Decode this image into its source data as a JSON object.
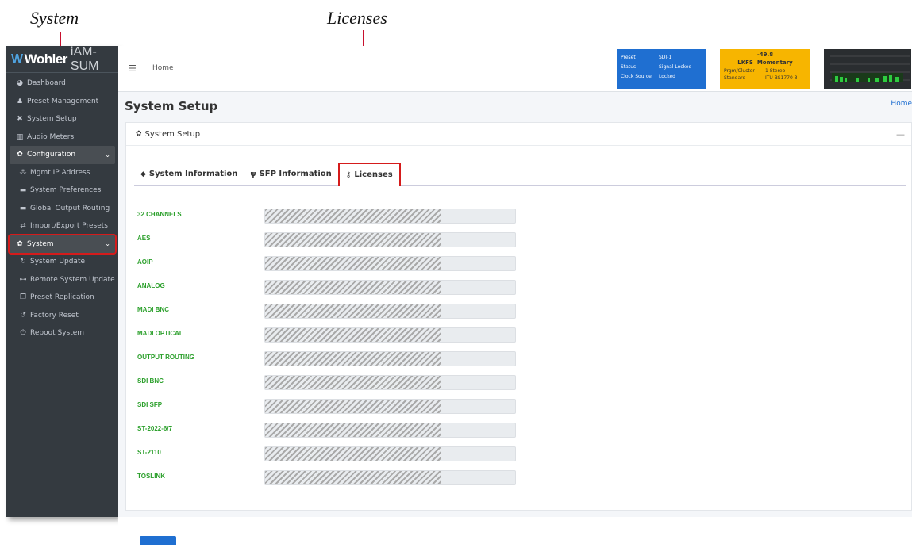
{
  "callouts": {
    "system": "System",
    "licenses": "Licenses"
  },
  "brand": {
    "logo": "Wohler",
    "product": "iAM-SUM"
  },
  "sidebar": {
    "items": [
      {
        "label": "Dashboard",
        "icon": "dashboard-icon"
      },
      {
        "label": "Preset Management",
        "icon": "users-icon"
      },
      {
        "label": "System Setup",
        "icon": "tools-icon"
      },
      {
        "label": "Audio Meters",
        "icon": "chart-icon"
      },
      {
        "label": "Configuration",
        "icon": "gear-icon"
      },
      {
        "label": "Mgmt IP Address",
        "icon": "network-icon"
      },
      {
        "label": "System Preferences",
        "icon": "keyboard-icon"
      },
      {
        "label": "Global Output Routing",
        "icon": "routing-icon"
      },
      {
        "label": "Import/Export Presets",
        "icon": "exchange-icon"
      },
      {
        "label": "System",
        "icon": "cogs-icon"
      },
      {
        "label": "System Update",
        "icon": "sync-icon"
      },
      {
        "label": "Remote System Update",
        "icon": "sitemap-icon"
      },
      {
        "label": "Preset Replication",
        "icon": "copy-icon"
      },
      {
        "label": "Factory Reset",
        "icon": "undo-icon"
      },
      {
        "label": "Reboot System",
        "icon": "power-icon"
      }
    ]
  },
  "topbar": {
    "home": "Home",
    "status_blue": [
      {
        "k": "Preset",
        "v": "SDI-1"
      },
      {
        "k": "Status",
        "v": "Signal Locked"
      },
      {
        "k": "Clock Source",
        "v": "Locked"
      }
    ],
    "status_yellow": {
      "value": "-49.8",
      "mode_k": "LKFS",
      "mode_v": "Momentary",
      "rows": [
        {
          "k": "Prgm/Cluster",
          "v": "1  Stereo"
        },
        {
          "k": "Standard",
          "v": "ITU BS1770 3"
        }
      ]
    }
  },
  "page": {
    "title": "System Setup",
    "breadcrumb": "Home",
    "card_title": "System Setup",
    "tabs": [
      {
        "label": "System Information",
        "icon": "tag-icon"
      },
      {
        "label": "SFP Information",
        "icon": "plug-icon"
      },
      {
        "label": "Licenses",
        "icon": "key-icon"
      }
    ],
    "licenses": [
      {
        "label": "32 CHANNELS",
        "level": 0.7
      },
      {
        "label": "AES",
        "level": 0.7
      },
      {
        "label": "AOIP",
        "level": 0.7
      },
      {
        "label": "ANALOG",
        "level": 0.7
      },
      {
        "label": "MADI BNC",
        "level": 0.7
      },
      {
        "label": "MADI OPTICAL",
        "level": 0.7
      },
      {
        "label": "OUTPUT ROUTING",
        "level": 0.7
      },
      {
        "label": "SDI BNC",
        "level": 0.7
      },
      {
        "label": "SDI SFP",
        "level": 0.7
      },
      {
        "label": "ST-2022-6/7",
        "level": 0.7
      },
      {
        "label": "ST-2110",
        "level": 0.7
      },
      {
        "label": "TOSLINK",
        "level": 0.7
      }
    ]
  },
  "colors": {
    "accent": "#1f6fd1",
    "highlight": "#d51b1b",
    "license_green": "#2ca02c",
    "sidebar": "#343a40",
    "status_yellow": "#f7b500"
  }
}
